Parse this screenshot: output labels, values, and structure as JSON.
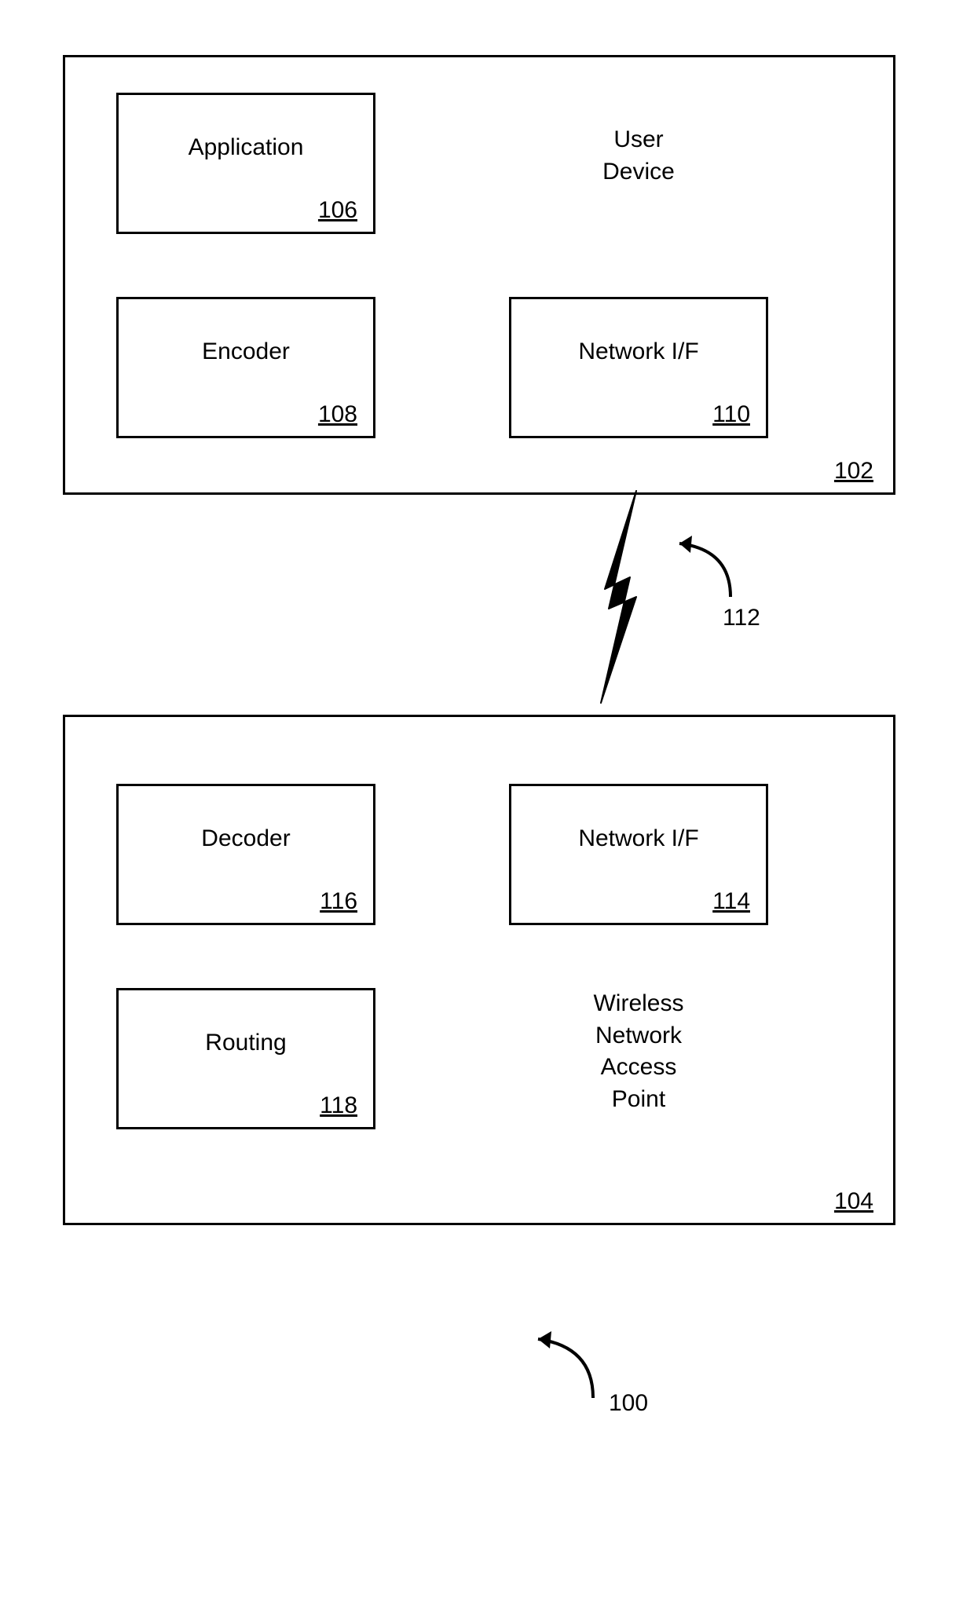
{
  "user_device": {
    "title_line1": "User",
    "title_line2": "Device",
    "ref": "102",
    "application": {
      "label": "Application",
      "ref": "106"
    },
    "encoder": {
      "label": "Encoder",
      "ref": "108"
    },
    "network_if": {
      "label": "Network I/F",
      "ref": "110"
    }
  },
  "wireless_link": {
    "ref": "112"
  },
  "access_point": {
    "title_line1": "Wireless",
    "title_line2": "Network",
    "title_line3": "Access",
    "title_line4": "Point",
    "ref": "104",
    "decoder": {
      "label": "Decoder",
      "ref": "116"
    },
    "network_if": {
      "label": "Network I/F",
      "ref": "114"
    },
    "routing": {
      "label": "Routing",
      "ref": "118"
    }
  },
  "figure": {
    "ref": "100"
  }
}
